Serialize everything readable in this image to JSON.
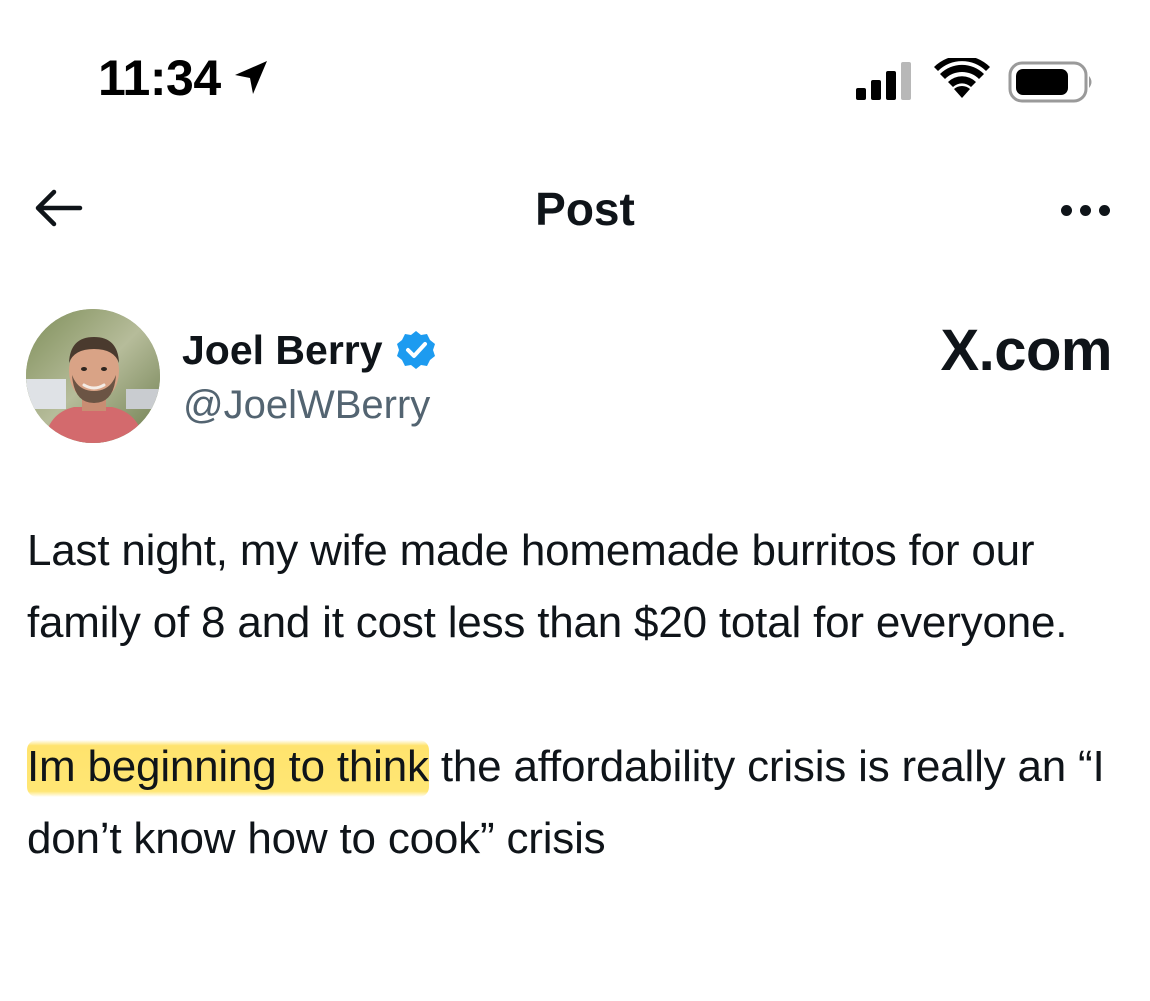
{
  "status_bar": {
    "time": "11:34",
    "icons": [
      "location-arrow-icon",
      "cellular-signal-icon",
      "wifi-icon",
      "battery-icon"
    ]
  },
  "header": {
    "title": "Post",
    "back_icon": "arrow-left-icon",
    "more_icon": "more-horizontal-icon"
  },
  "author": {
    "name": "Joel Berry",
    "handle": "@JoelWBerry",
    "verified": true,
    "verified_icon": "verified-badge-icon"
  },
  "watermark": {
    "text": "X.com"
  },
  "post": {
    "paragraph_1": "Last night, my wife made homemade burritos for our family of 8 and it cost less than $20 total for everyone.",
    "paragraph_2_highlighted": "Im beginning to think",
    "paragraph_2_rest": " the affordability crisis is really an “I don’t know how to cook” crisis"
  },
  "colors": {
    "text_primary": "#0f1419",
    "text_secondary": "#536471",
    "verified_blue": "#1d9bf0",
    "highlight_yellow": "#ffde54"
  }
}
